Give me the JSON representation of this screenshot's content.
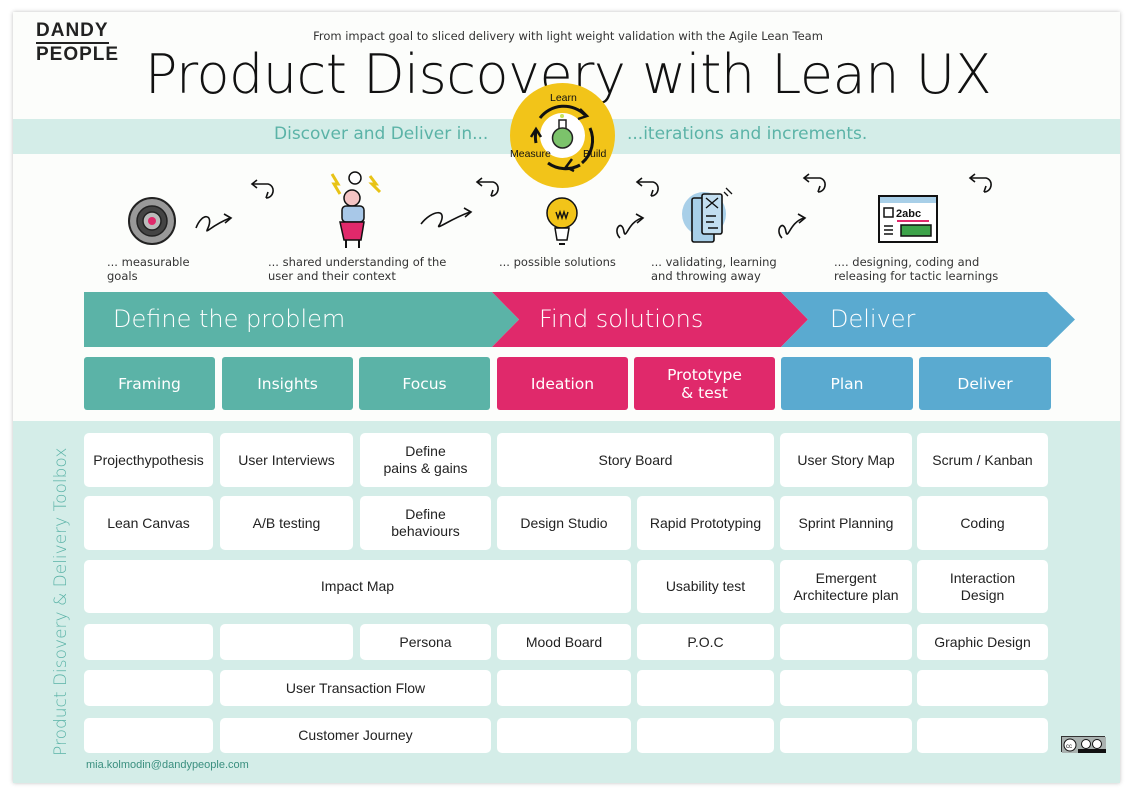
{
  "logo": {
    "line1": "DANDY",
    "line2": "PEOPLE"
  },
  "header": {
    "subtitle": "From impact goal to sliced delivery with light weight validation with the Agile Lean Team",
    "title": "Product Discovery with Lean UX"
  },
  "band": {
    "left_text": "Discover  and Deliver in...",
    "right_text": "...iterations and increments."
  },
  "loop": {
    "learn": "Learn",
    "measure": "Measure",
    "build": "Build",
    "icon": "flask-icon"
  },
  "steps": [
    {
      "text": "... measurable goals",
      "icon": "target-icon"
    },
    {
      "text": "... shared understanding of the user and their context",
      "icon": "stressed-user-icon"
    },
    {
      "text": "... possible solutions",
      "icon": "lightbulb-icon"
    },
    {
      "text": "... validating, learning and throwing away",
      "icon": "prototype-screens-icon"
    },
    {
      "text": ".... designing, coding and releasing for tactic learnings",
      "icon": "browser-window-icon"
    }
  ],
  "phases": [
    {
      "label": "Define the problem",
      "color": "#5bb3a7"
    },
    {
      "label": "Find solutions",
      "color": "#e0296b"
    },
    {
      "label": "Deliver",
      "color": "#5aaad0"
    }
  ],
  "subphases": [
    {
      "label": "Framing",
      "color": "#5bb3a7"
    },
    {
      "label": "Insights",
      "color": "#5bb3a7"
    },
    {
      "label": "Focus",
      "color": "#5bb3a7"
    },
    {
      "label": "Ideation",
      "color": "#e0296b"
    },
    {
      "label": "Prototype\n& test",
      "color": "#e0296b"
    },
    {
      "label": "Plan",
      "color": "#5aaad0"
    },
    {
      "label": "Deliver",
      "color": "#5aaad0"
    }
  ],
  "toolbox": {
    "label": "Product Disovery & Delivery Toolbox",
    "tools": [
      "Projecthypothesis",
      "User Interviews",
      "Define\npains & gains",
      "Story Board",
      "User Story Map",
      "Scrum / Kanban",
      "Lean Canvas",
      "A/B testing",
      "Define\nbehaviours",
      "Design Studio",
      "Rapid Prototyping",
      "Sprint Planning",
      "Coding",
      "Impact Map",
      "Usability test",
      "Emergent\nArchitecture plan",
      "Interaction\nDesign",
      "",
      "",
      "Persona",
      "Mood Board",
      "P.O.C",
      "",
      "Graphic Design",
      "",
      "User Transaction Flow",
      "",
      "",
      "",
      "",
      "",
      "Customer Journey",
      "",
      "",
      "",
      ""
    ]
  },
  "footer": {
    "email": "mia.kolmodin@dandypeople.com",
    "license": "CC BY SA"
  }
}
